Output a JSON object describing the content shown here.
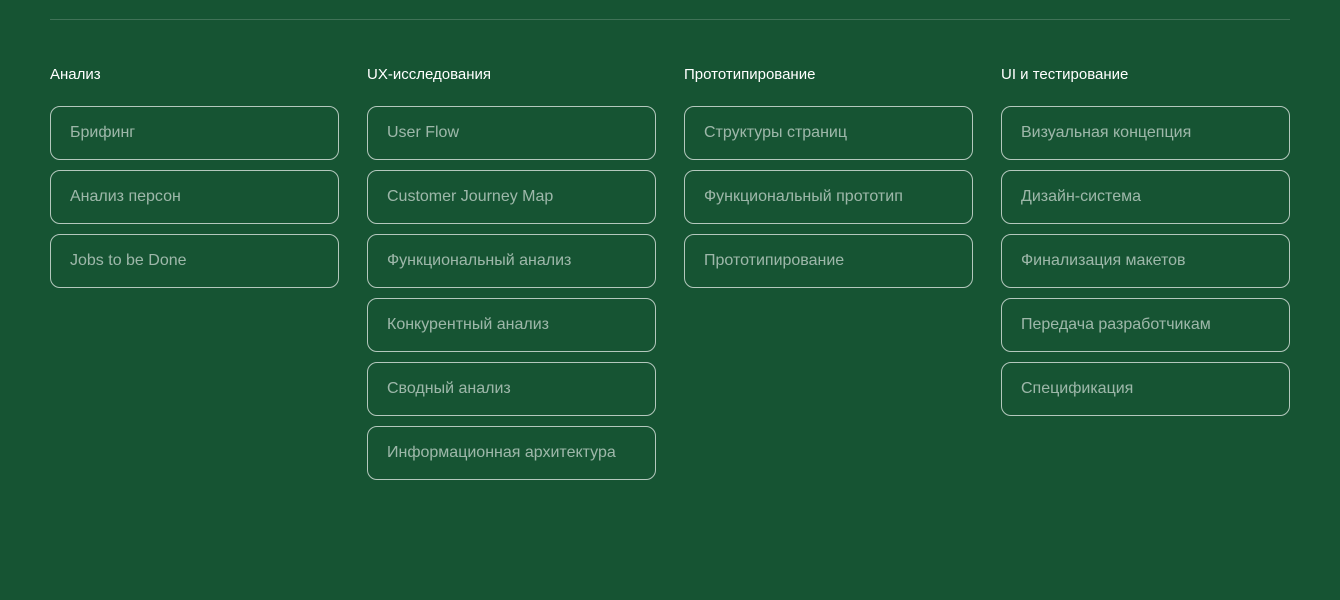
{
  "columns": [
    {
      "title": "Анализ",
      "items": [
        "Брифинг",
        "Анализ персон",
        "Jobs to be Done"
      ]
    },
    {
      "title": "UX-исследования",
      "items": [
        "User Flow",
        "Customer Journey Map",
        "Функциональный анализ",
        "Конкурентный анализ",
        "Сводный анализ",
        "Информационная архитектура"
      ]
    },
    {
      "title": "Прототипирование",
      "items": [
        "Структуры страниц",
        "Функциональный прототип",
        "Прототипирование"
      ]
    },
    {
      "title": "UI и тестирование",
      "items": [
        "Визуальная концепция",
        "Дизайн-система",
        "Финализация макетов",
        "Передача разработчикам",
        "Спецификация"
      ]
    }
  ]
}
